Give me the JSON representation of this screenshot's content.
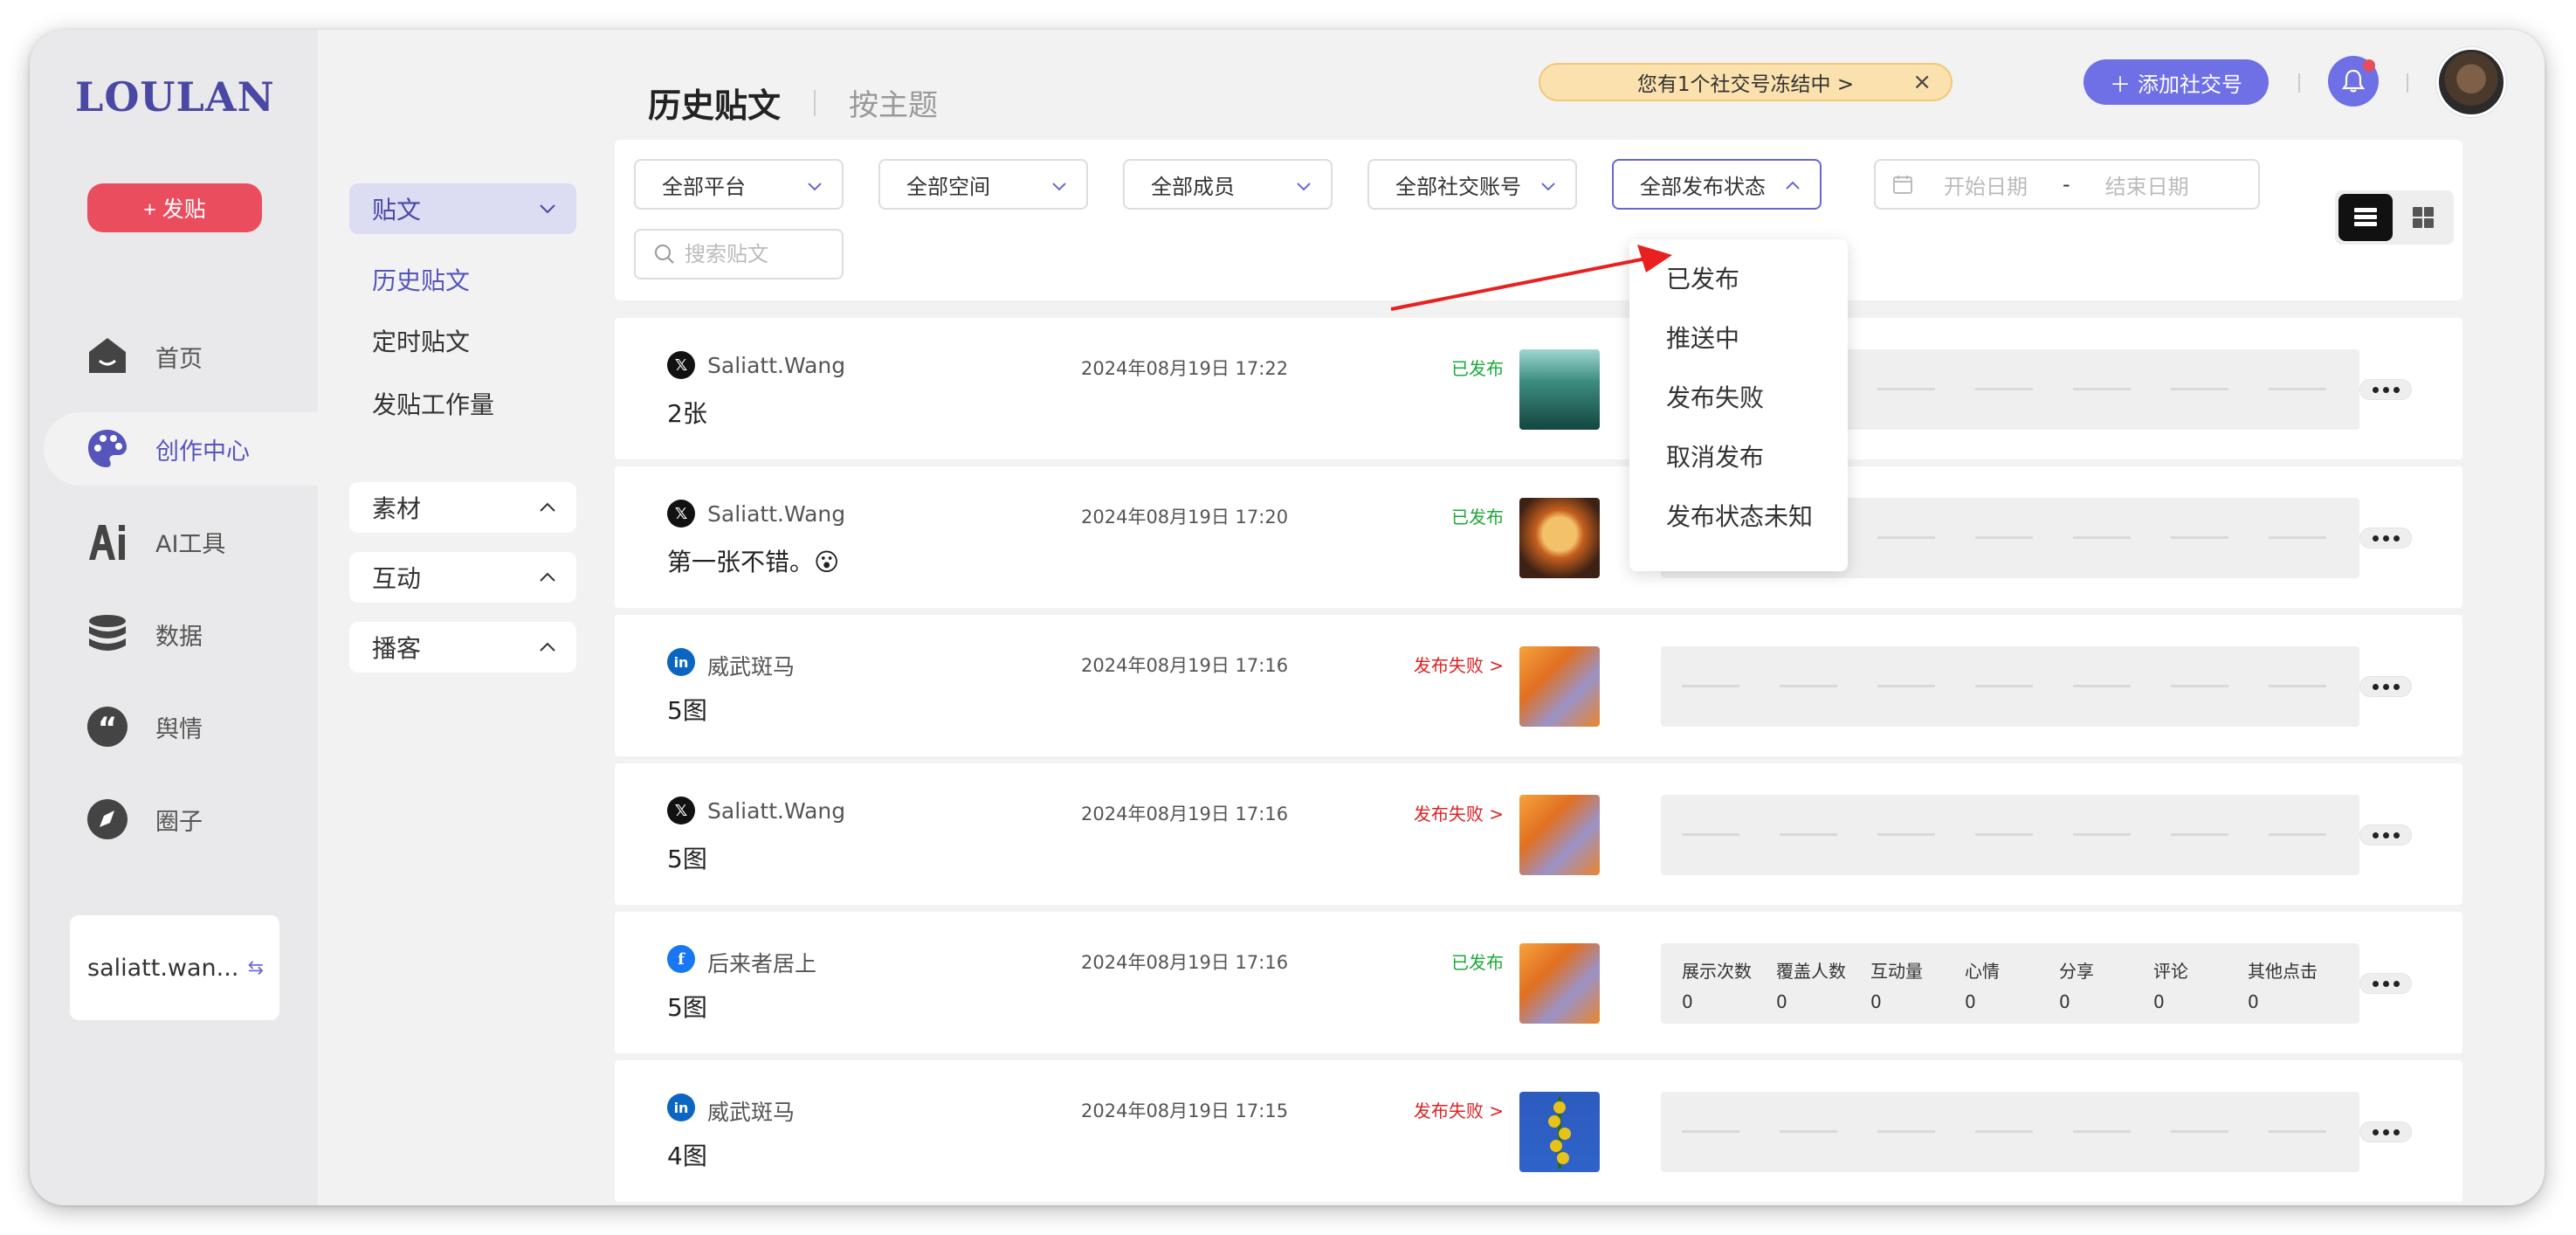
{
  "app": {
    "logo": "LOULAN"
  },
  "leftnav": {
    "post_button": "+ 发贴",
    "items": [
      {
        "label": "首页",
        "icon": "home-icon"
      },
      {
        "label": "创作中心",
        "icon": "palette-icon",
        "active": true
      },
      {
        "label": "AI工具",
        "icon": "ai-icon"
      },
      {
        "label": "数据",
        "icon": "database-icon"
      },
      {
        "label": "舆情",
        "icon": "quote-icon"
      },
      {
        "label": "圈子",
        "icon": "compass-icon"
      }
    ],
    "account": {
      "name": "saliatt.wan...",
      "switch_icon": "switch-icon"
    }
  },
  "subnav": {
    "posts_header": "贴文",
    "posts_links": [
      "历史贴文",
      "定时贴文",
      "发贴工作量"
    ],
    "material": "素材",
    "interaction": "互动",
    "podcast": "播客"
  },
  "header": {
    "tab_active": "历史贴文",
    "tab_other": "按主题",
    "frozen_banner": "您有1个社交号冻结中 >",
    "close_icon": "close-icon",
    "add_social": "添加社交号",
    "accent_color": "#6f6fe6",
    "danger_color": "#e94d5e"
  },
  "filters": {
    "platform": "全部平台",
    "space": "全部空间",
    "member": "全部成员",
    "social_account": "全部社交账号",
    "publish_status": "全部发布状态",
    "start_date": "开始日期",
    "date_sep": "-",
    "end_date": "结束日期",
    "search_placeholder": "搜索贴文"
  },
  "status_dropdown": {
    "options": [
      "已发布",
      "推送中",
      "发布失败",
      "取消发布",
      "发布状态未知"
    ]
  },
  "posts": [
    {
      "platform": "x",
      "account": "Saliatt.Wang",
      "content": "2张",
      "time": "2024年08月19日 17:22",
      "status": "已发布",
      "status_type": "ok",
      "thumb": "forest"
    },
    {
      "platform": "x",
      "account": "Saliatt.Wang",
      "content": "第一张不错。😮",
      "time": "2024年08月19日 17:20",
      "status": "已发布",
      "status_type": "ok",
      "thumb": "moon"
    },
    {
      "platform": "linkedin",
      "account": "威武斑马",
      "content": "5图",
      "time": "2024年08月19日 17:16",
      "status": "发布失败 >",
      "status_type": "fail",
      "thumb": "leaves"
    },
    {
      "platform": "x",
      "account": "Saliatt.Wang",
      "content": "5图",
      "time": "2024年08月19日 17:16",
      "status": "发布失败 >",
      "status_type": "fail",
      "thumb": "leaves"
    },
    {
      "platform": "facebook",
      "account": "后来者居上",
      "content": "5图",
      "time": "2024年08月19日 17:16",
      "status": "已发布",
      "status_type": "ok",
      "thumb": "leaves"
    },
    {
      "platform": "linkedin",
      "account": "威武斑马",
      "content": "4图",
      "time": "2024年08月19日 17:15",
      "status": "发布失败 >",
      "status_type": "fail",
      "thumb": "flowers"
    }
  ],
  "metrics": {
    "labels": [
      "展示次数",
      "覆盖人数",
      "互动量",
      "心情",
      "分享",
      "评论",
      "其他点击"
    ],
    "values": [
      "0",
      "0",
      "0",
      "0",
      "0",
      "0",
      "0"
    ]
  }
}
